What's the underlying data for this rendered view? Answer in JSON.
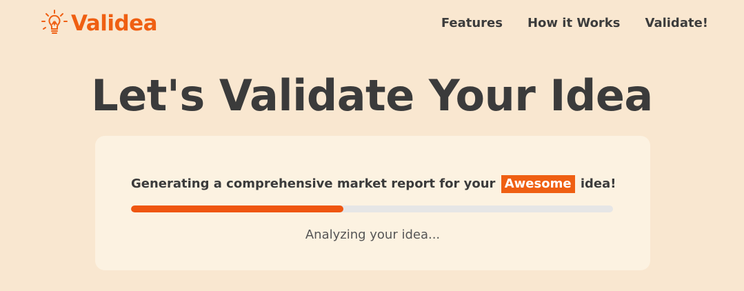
{
  "brand": {
    "name": "Validea",
    "color": "#ef5f12",
    "icon": "lightbulb-icon"
  },
  "nav": {
    "items": [
      {
        "label": "Features"
      },
      {
        "label": "How it Works"
      },
      {
        "label": "Validate!"
      }
    ]
  },
  "hero": {
    "title": "Let's Validate Your Idea"
  },
  "progress_card": {
    "message_before": "Generating a comprehensive market report for your",
    "highlight_word": "Awesome",
    "message_after": "idea!",
    "progress_fraction": 0.44,
    "status": "Analyzing your idea..."
  },
  "colors": {
    "background": "#f9e7d0",
    "card": "#fcf2e1",
    "accent": "#ef5f12",
    "track": "#e6e6e6",
    "text": "#3b3b3b"
  }
}
